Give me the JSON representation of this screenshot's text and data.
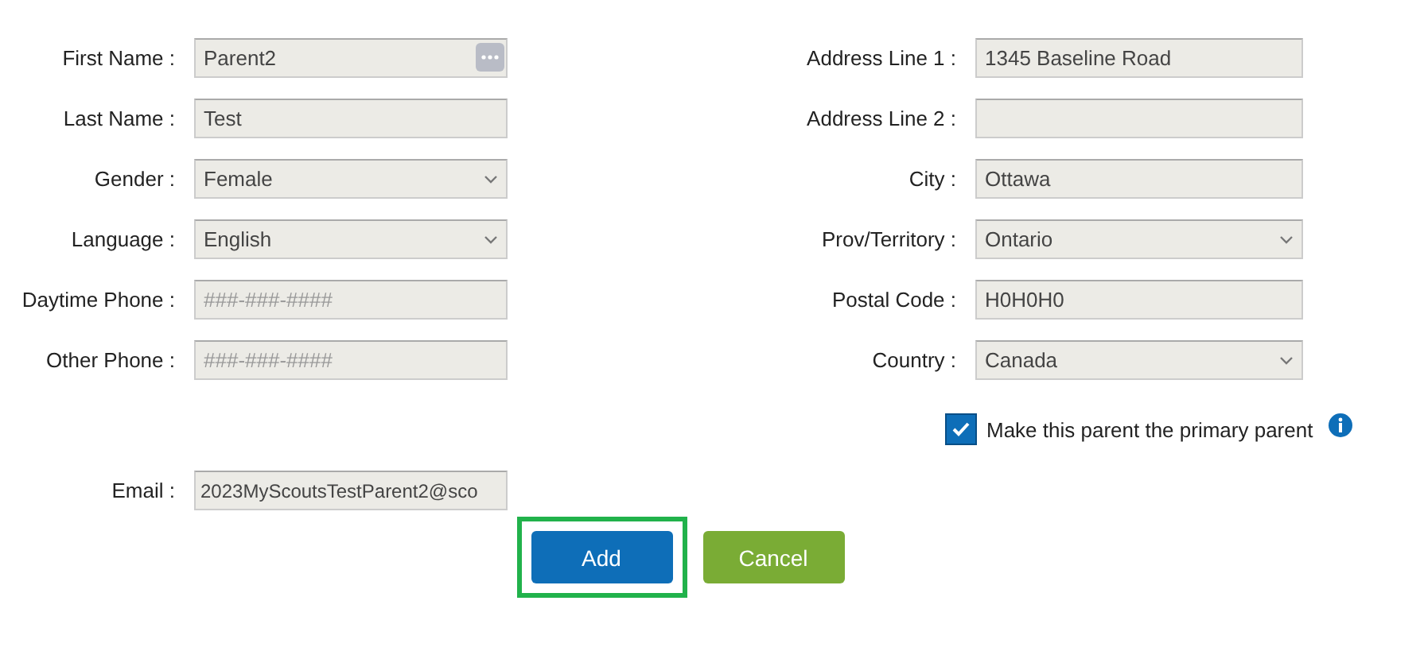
{
  "left_fields": [
    {
      "label": "First Name :",
      "kind": "text",
      "value": "Parent2",
      "menu_icon": true
    },
    {
      "label": "Last Name :",
      "kind": "text",
      "value": "Test"
    },
    {
      "label": "Gender :",
      "kind": "select",
      "value": "Female"
    },
    {
      "label": "Language :",
      "kind": "select",
      "value": "English"
    },
    {
      "label": "Daytime Phone :",
      "kind": "text",
      "placeholder": "###-###-####"
    },
    {
      "label": "Other Phone :",
      "kind": "text",
      "placeholder": "###-###-####"
    }
  ],
  "right_fields": [
    {
      "label": "Address Line 1 :",
      "kind": "text",
      "value": "1345 Baseline Road"
    },
    {
      "label": "Address Line 2 :",
      "kind": "text"
    },
    {
      "label": "City :",
      "kind": "text",
      "value": "Ottawa"
    },
    {
      "label": "Prov/Territory :",
      "kind": "select",
      "value": "Ontario"
    },
    {
      "label": "Postal Code :",
      "kind": "text",
      "value": "H0H0H0"
    },
    {
      "label": "Country :",
      "kind": "select",
      "value": "Canada"
    }
  ],
  "primary_parent": {
    "label": "Make this parent the primary parent",
    "checked": true
  },
  "email": {
    "label": "Email :",
    "value": "2023MyScoutsTestParent2@sco"
  },
  "buttons": [
    {
      "label": "Add",
      "kind": "primary",
      "highlighted": true
    },
    {
      "label": "Cancel",
      "kind": "secondary",
      "highlighted": false
    }
  ]
}
